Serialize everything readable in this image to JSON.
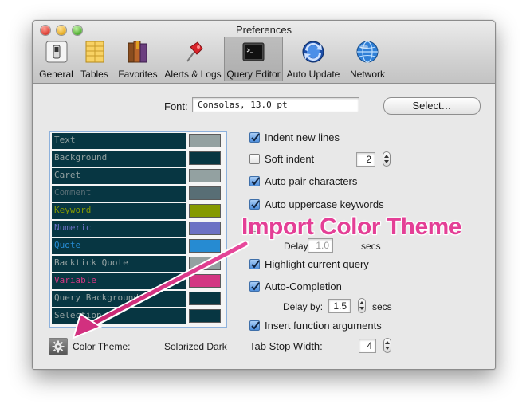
{
  "window": {
    "title": "Preferences"
  },
  "toolbar": {
    "items": [
      {
        "label": "General",
        "icon": "switch-icon"
      },
      {
        "label": "Tables",
        "icon": "table-icon"
      },
      {
        "label": "Favorites",
        "icon": "books-icon"
      },
      {
        "label": "Alerts & Logs",
        "icon": "pin-icon"
      },
      {
        "label": "Query Editor",
        "icon": "terminal-icon",
        "selected": true
      },
      {
        "label": "Auto Update",
        "icon": "sync-icon"
      },
      {
        "label": "Network",
        "icon": "globe-icon"
      }
    ]
  },
  "font": {
    "label": "Font:",
    "value": "Consolas, 13.0 pt",
    "select_button": "Select…"
  },
  "theme": {
    "rows": [
      {
        "name": "Text",
        "text_color": "#93a1a1",
        "swatch": "#93a1a1"
      },
      {
        "name": "Background",
        "text_color": "#93a1a1",
        "swatch": "#073642"
      },
      {
        "name": "Caret",
        "text_color": "#93a1a1",
        "swatch": "#93a1a1"
      },
      {
        "name": "Comment",
        "text_color": "#586e75",
        "swatch": "#586e75"
      },
      {
        "name": "Keyword",
        "text_color": "#859900",
        "swatch": "#859900"
      },
      {
        "name": "Numeric",
        "text_color": "#6c71c4",
        "swatch": "#6c71c4"
      },
      {
        "name": "Quote",
        "text_color": "#268bd2",
        "swatch": "#268bd2"
      },
      {
        "name": "Backtick Quote",
        "text_color": "#93a1a1",
        "swatch": "#93a1a1"
      },
      {
        "name": "Variable",
        "text_color": "#d33682",
        "swatch": "#d33682"
      },
      {
        "name": "Query Background",
        "text_color": "#93a1a1",
        "swatch": "#073642"
      },
      {
        "name": "Selection",
        "text_color": "#93a1a1",
        "swatch": "#073642"
      }
    ],
    "color_theme_label": "Color Theme:",
    "color_theme_value": "Solarized Dark"
  },
  "options": {
    "indent_new_lines": {
      "label": "Indent new lines",
      "checked": true
    },
    "soft_indent": {
      "label": "Soft indent",
      "checked": false,
      "value": "2"
    },
    "auto_pair": {
      "label": "Auto pair characters",
      "checked": true
    },
    "auto_uppercase": {
      "label": "Auto uppercase keywords",
      "checked": true
    },
    "hidden_option": {
      "delay_label": "Delay by:",
      "delay_value": "1.0",
      "delay_unit": "secs"
    },
    "highlight_query": {
      "label": "Highlight current query",
      "checked": true
    },
    "auto_completion": {
      "label": "Auto-Completion",
      "checked": true,
      "delay_label": "Delay by:",
      "delay_value": "1.5",
      "delay_unit": "secs"
    },
    "insert_function_args": {
      "label": "Insert function arguments",
      "checked": true
    },
    "tab_stop": {
      "label": "Tab Stop Width:",
      "value": "4"
    }
  },
  "annotation": {
    "text": "Import Color Theme",
    "color": "#e43f96"
  }
}
